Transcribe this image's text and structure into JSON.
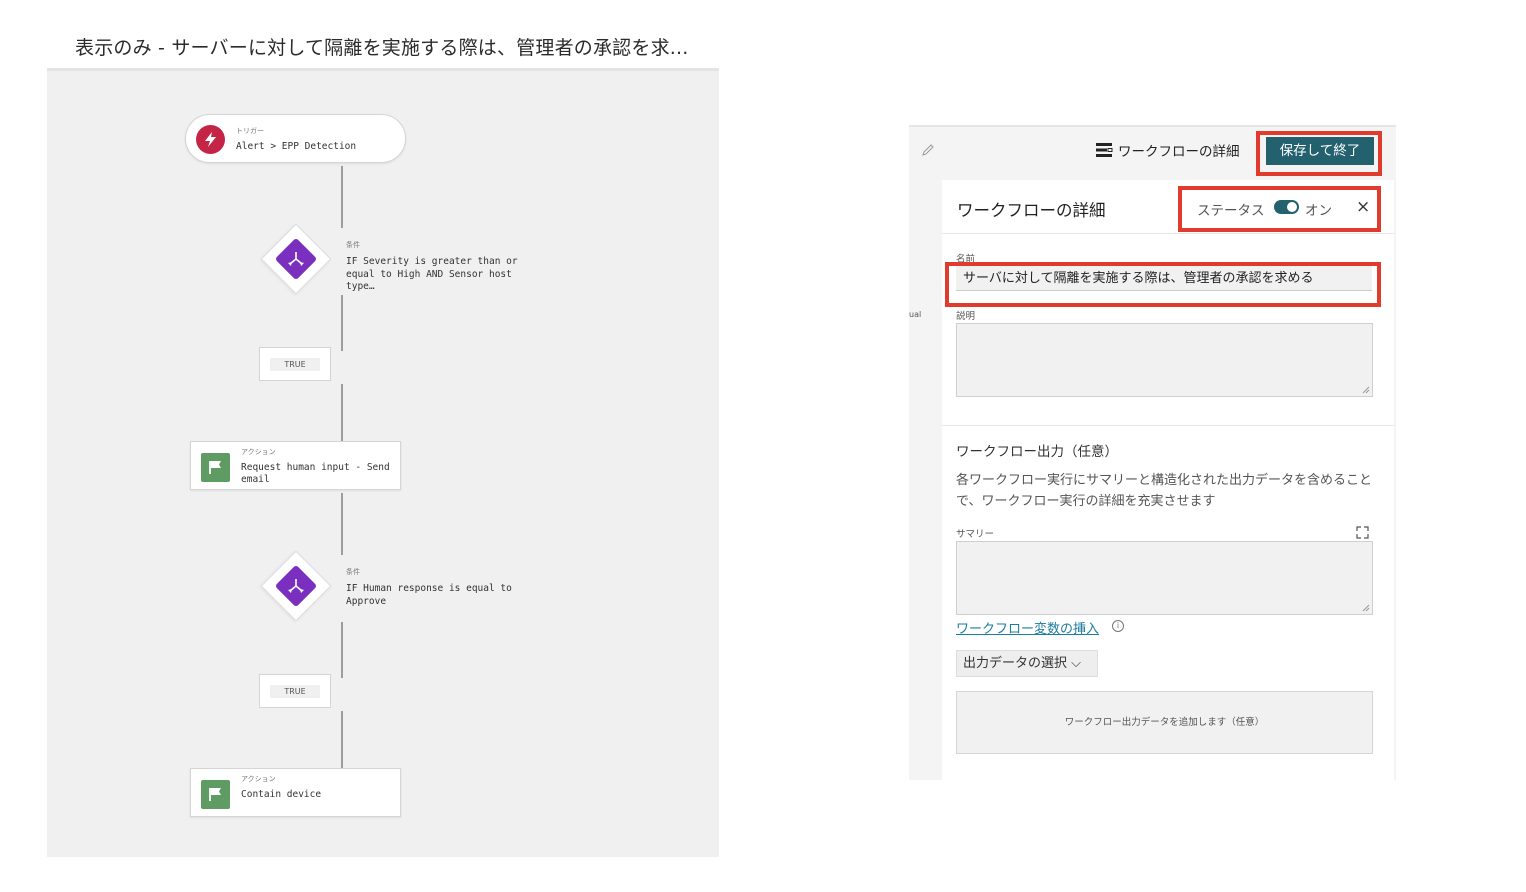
{
  "caption": "表示のみ - サーバーに対して隔離を実施する際は、管理者の承認を求...",
  "workflow": {
    "trigger": {
      "type_label": "トリガー",
      "text": "Alert > EPP Detection"
    },
    "condition1": {
      "type_label": "条件",
      "text": "IF Severity is greater than or equal to High AND Sensor host type…"
    },
    "true1": "TRUE",
    "action1": {
      "type_label": "アクション",
      "text": "Request human input - Send email"
    },
    "condition2": {
      "type_label": "条件",
      "text": "IF Human response is equal to Approve"
    },
    "true2": "TRUE",
    "action2": {
      "type_label": "アクション",
      "text": "Contain device"
    }
  },
  "panel": {
    "fragment_text": "ual",
    "topbar": {
      "details_link": "ワークフローの詳細",
      "save_button": "保存して終了"
    },
    "sheet": {
      "title": "ワークフローの詳細",
      "status_label": "ステータス",
      "status_value": "オン",
      "close": "×",
      "name_label": "名前",
      "name_value": "サーバに対して隔離を実施する際は、管理者の承認を求める",
      "description_label": "説明",
      "output_section_title": "ワークフロー出力（任意）",
      "output_section_desc": "各ワークフロー実行にサマリーと構造化された出力データを含めることで、ワークフロー実行の詳細を充実させます",
      "summary_label": "サマリー",
      "insert_variable_link": "ワークフロー変数の挿入",
      "info": "i",
      "select_output": "出力データの選択 ⌵",
      "add_output_placeholder": "ワークフロー出力データを追加します（任意）"
    }
  },
  "colors": {
    "save_button_bg": "#23616f",
    "trigger_icon": "#c42446",
    "condition_icon": "#7b2fbf",
    "action_icon": "#5e9c63",
    "highlight": "#e03c2e",
    "link": "#1a7ca0"
  }
}
